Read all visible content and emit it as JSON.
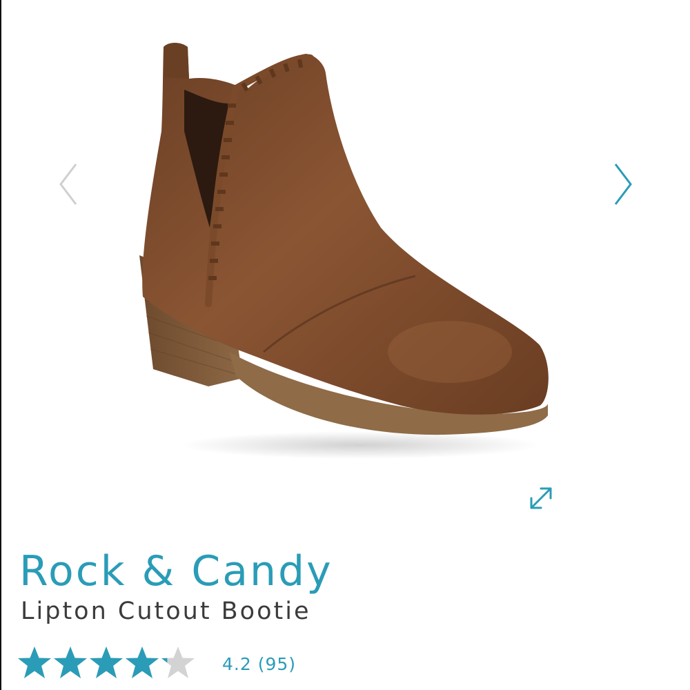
{
  "product": {
    "brand": "Rock & Candy",
    "name": "Lipton Cutout Bootie",
    "rating_value": "4.2",
    "review_count": "(95)",
    "rating_fraction": 0.84
  },
  "gallery": {
    "prev_icon": "chevron-left-icon",
    "next_icon": "chevron-right-icon",
    "expand_icon": "expand-arrows-icon"
  },
  "colors": {
    "accent": "#2a9cb7",
    "text": "#3b3b3b",
    "arrow_inactive": "#cfcfcf",
    "star_empty": "#d3d3d3",
    "boot_leather": "#7a4a2c",
    "boot_sole": "#8a6845"
  }
}
